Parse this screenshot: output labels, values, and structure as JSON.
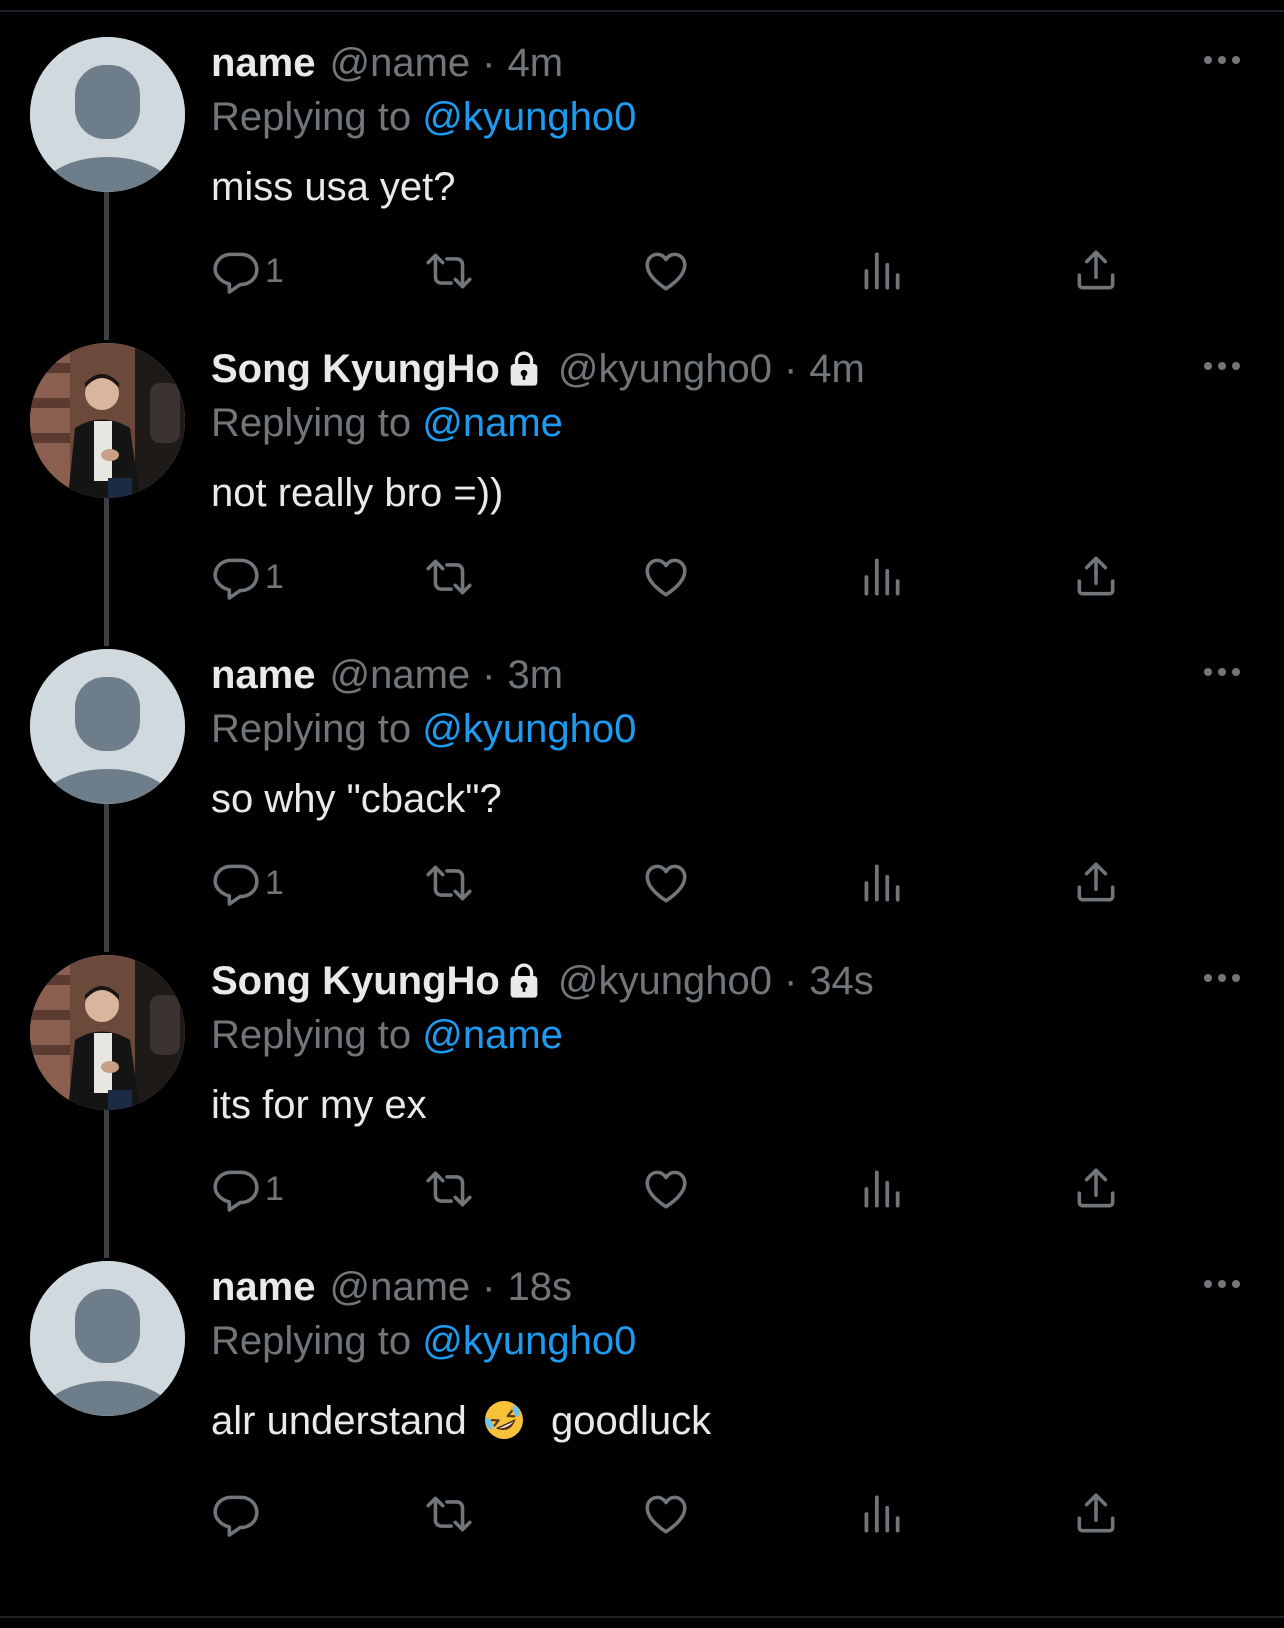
{
  "tweets": [
    {
      "name": "name",
      "handle": "@name",
      "separator": "·",
      "time": "4m",
      "replying_prefix": "Replying to",
      "reply_to": "@kyungho0",
      "text": "miss usa yet?",
      "reply_count": "1",
      "avatar": "default",
      "locked": false
    },
    {
      "name": "Song KyungHo",
      "handle": "@kyungho0",
      "separator": "·",
      "time": "4m",
      "replying_prefix": "Replying to",
      "reply_to": "@name",
      "text": "not really bro =))",
      "reply_count": "1",
      "avatar": "photo",
      "locked": true
    },
    {
      "name": "name",
      "handle": "@name",
      "separator": "·",
      "time": "3m",
      "replying_prefix": "Replying to",
      "reply_to": "@kyungho0",
      "text": "so why \"cback\"?",
      "reply_count": "1",
      "avatar": "default",
      "locked": false
    },
    {
      "name": "Song KyungHo",
      "handle": "@kyungho0",
      "separator": "·",
      "time": "34s",
      "replying_prefix": "Replying to",
      "reply_to": "@name",
      "text": "its for my ex",
      "reply_count": "1",
      "avatar": "photo",
      "locked": true
    },
    {
      "name": "name",
      "handle": "@name",
      "separator": "·",
      "time": "18s",
      "replying_prefix": "Replying to",
      "reply_to": "@kyungho0",
      "text": "alr understand",
      "text_after_emoji": "goodluck",
      "emoji": "rolling-on-floor-laughing",
      "reply_count": "",
      "avatar": "default",
      "locked": false
    }
  ],
  "icons": {
    "more": "more-icon",
    "reply": "reply-icon",
    "retweet": "retweet-icon",
    "like": "heart-icon",
    "views": "views-icon",
    "share": "share-icon",
    "lock": "lock-icon"
  },
  "colors": {
    "background": "#000000",
    "text": "#e7e9ea",
    "muted": "#71767b",
    "mention": "#1d9bf0",
    "thread_line": "#3a3f44"
  }
}
